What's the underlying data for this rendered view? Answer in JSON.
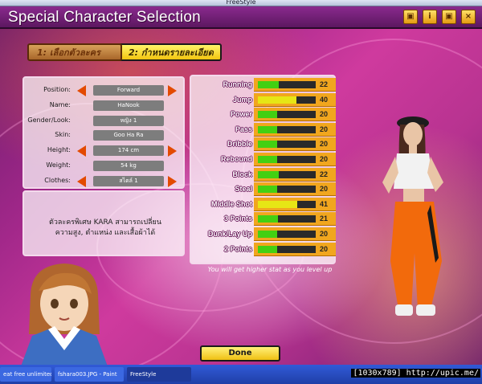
{
  "window": {
    "title": "FreeStyle"
  },
  "header": {
    "title": "Special Character Selection",
    "buttons": [
      "cube-icon",
      "info-icon",
      "cube-icon",
      "close-icon"
    ]
  },
  "steps": {
    "step1": "1: เลือกตัวละคร",
    "step2": "2: กำหนดรายละเอียด"
  },
  "info": {
    "rows": [
      {
        "label": "Position:",
        "value": "Forward",
        "arrows": true
      },
      {
        "label": "Name:",
        "value": "HaNook",
        "arrows": false
      },
      {
        "label": "Gender/Look:",
        "value": "หญิง 1",
        "arrows": false
      },
      {
        "label": "Skin:",
        "value": "Goo Ha Ra",
        "arrows": false
      },
      {
        "label": "Height:",
        "value": "174 cm",
        "arrows": true
      },
      {
        "label": "Weight:",
        "value": "54 kg",
        "arrows": false
      },
      {
        "label": "Clothes:",
        "value": "สไตล์ 1",
        "arrows": true
      }
    ]
  },
  "description": {
    "line1": "ตัวละครพิเศษ KARA สามารถเปลี่ยน",
    "line2": "ความสูง, ตำแหน่ง และเสื้อผ้าได้"
  },
  "stats": [
    {
      "name": "Running",
      "value": 22
    },
    {
      "name": "Jump",
      "value": 40
    },
    {
      "name": "Power",
      "value": 20
    },
    {
      "name": "Pass",
      "value": 20
    },
    {
      "name": "Dribble",
      "value": 20
    },
    {
      "name": "Rebound",
      "value": 20
    },
    {
      "name": "Block",
      "value": 22
    },
    {
      "name": "Steal",
      "value": 20
    },
    {
      "name": "Middle Shot",
      "value": 41
    },
    {
      "name": "3 Points",
      "value": 21
    },
    {
      "name": "Dunk/Lay Up",
      "value": 20
    },
    {
      "name": "2 Points",
      "value": 20
    }
  ],
  "level_note": "You will get higher stat as you level up",
  "done_label": "Done",
  "taskbar": {
    "items": [
      "eat free unlimited ...",
      "fshara003.JPG - Paint",
      "FreeStyle"
    ]
  },
  "watermark": "[1030x789] http://upic.me/",
  "colors": {
    "stat_fill": "#43d012",
    "stat_fill_high": "#e6e615",
    "arrow": "#e34a00",
    "accent": "#f3c410"
  }
}
